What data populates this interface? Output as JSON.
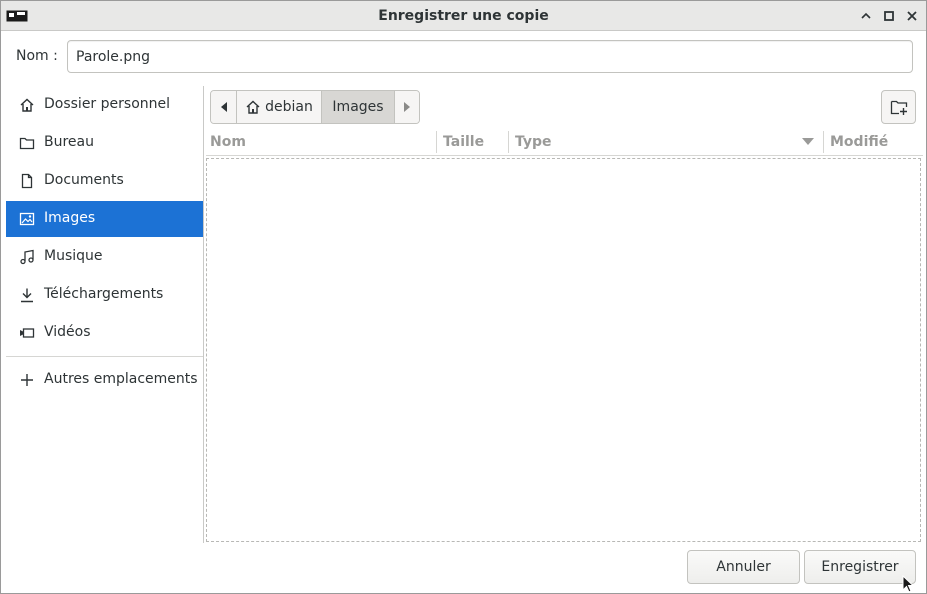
{
  "window": {
    "title": "Enregistrer une copie",
    "app_icon": "app-window-icon",
    "controls": [
      "minimize-icon",
      "maximize-icon",
      "close-icon"
    ]
  },
  "name_field": {
    "label": "Nom :",
    "value": "Parole.png"
  },
  "sidebar": {
    "items": [
      {
        "label": "Dossier personnel",
        "icon": "home-icon",
        "selected": false
      },
      {
        "label": "Bureau",
        "icon": "folder-icon",
        "selected": false
      },
      {
        "label": "Documents",
        "icon": "document-icon",
        "selected": false
      },
      {
        "label": "Images",
        "icon": "image-icon",
        "selected": true
      },
      {
        "label": "Musique",
        "icon": "music-icon",
        "selected": false
      },
      {
        "label": "Téléchargements",
        "icon": "download-icon",
        "selected": false
      },
      {
        "label": "Vidéos",
        "icon": "video-icon",
        "selected": false
      }
    ],
    "other_locations": {
      "label": "Autres emplacements",
      "icon": "plus-icon"
    }
  },
  "pathbar": {
    "segments": [
      {
        "label": "debian",
        "icon": "home-icon"
      },
      {
        "label": "Images",
        "active": true
      }
    ]
  },
  "columns": {
    "name": "Nom",
    "size": "Taille",
    "type": "Type",
    "modified": "Modifié"
  },
  "buttons": {
    "cancel": "Annuler",
    "save": "Enregistrer"
  },
  "colors": {
    "selection": "#1c72d5",
    "titlebar": "#e8e8e7"
  }
}
